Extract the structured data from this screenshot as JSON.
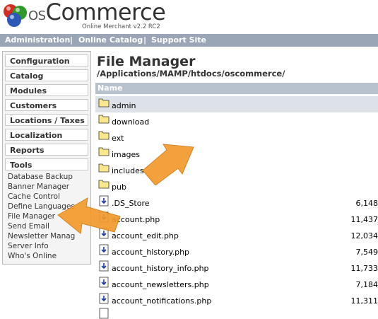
{
  "logo": {
    "brand_prefix": "os",
    "brand_main": "Commerce",
    "subtitle": "Online Merchant v2.2 RC2"
  },
  "topnav": {
    "items": [
      "Administration",
      "Online Catalog",
      "Support Site"
    ],
    "separator": "|"
  },
  "sidebar": {
    "headings": [
      "Configuration",
      "Catalog",
      "Modules",
      "Customers",
      "Locations / Taxes",
      "Localization",
      "Reports",
      "Tools"
    ],
    "tools_links": [
      "Database Backup",
      "Banner Manager",
      "Cache Control",
      "Define Languages",
      "File Manager",
      "Send Email",
      "Newsletter Manag",
      "Server Info",
      "Who's Online"
    ]
  },
  "main": {
    "title": "File Manager",
    "path": "/Applications/MAMP/htdocs/oscommerce/",
    "table_header": "Name",
    "folders": [
      "admin",
      "download",
      "ext",
      "images",
      "includes",
      "pub"
    ],
    "files": [
      {
        "name": ".DS_Store",
        "size": "6,148"
      },
      {
        "name": "account.php",
        "size": "11,437"
      },
      {
        "name": "account_edit.php",
        "size": "12,034"
      },
      {
        "name": "account_history.php",
        "size": "7,549"
      },
      {
        "name": "account_history_info.php",
        "size": "11,733"
      },
      {
        "name": "account_newsletters.php",
        "size": "7,184"
      },
      {
        "name": "account_notifications.php",
        "size": "11,311"
      }
    ]
  },
  "colors": {
    "nav_bar": "#9aa6b6",
    "table_header": "#b8c2cf",
    "selected_row": "#dde2e9",
    "arrow": "#f39a2c"
  }
}
